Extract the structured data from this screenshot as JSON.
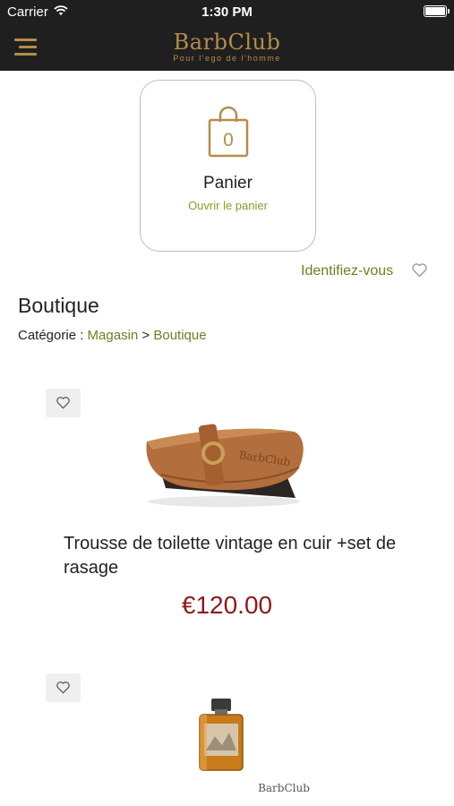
{
  "status_bar": {
    "carrier": "Carrier",
    "time": "1:30 PM"
  },
  "header": {
    "brand": "BarbClub",
    "tagline": "Pour l'ego de l'homme",
    "brand_color": "#b58d4a",
    "background_color": "#1f1f1f"
  },
  "cart": {
    "count": "0",
    "title": "Panier",
    "open_label": "Ouvrir le panier"
  },
  "account": {
    "login_label": "Identifiez-vous"
  },
  "page": {
    "title": "Boutique",
    "breadcrumb": {
      "prefix": "Catégorie : ",
      "items": [
        "Magasin",
        "Boutique"
      ],
      "separator": " > "
    }
  },
  "products": [
    {
      "title": "Trousse de toilette vintage en cuir +set de rasage",
      "price": "€120.00",
      "image_brand": "BarbClub"
    },
    {
      "title": "",
      "price": "",
      "image_brand": "BarbClub"
    }
  ],
  "colors": {
    "accent_link": "#6f7d22",
    "price": "#8e1a1a"
  }
}
